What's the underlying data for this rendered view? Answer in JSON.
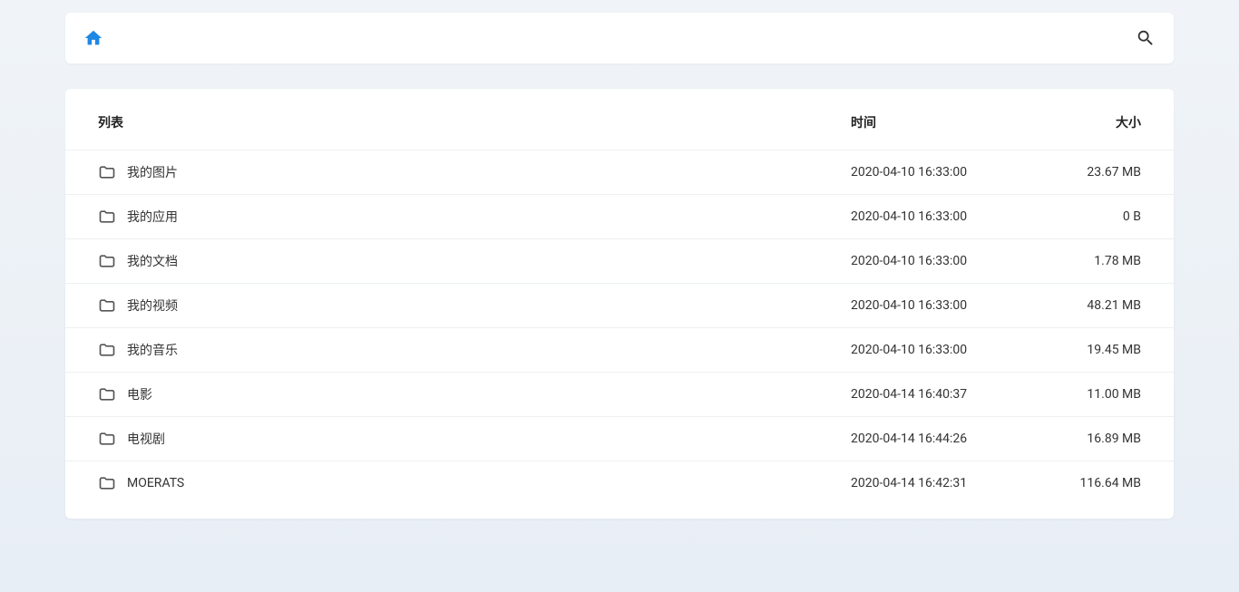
{
  "header": {
    "nameLabel": "列表",
    "timeLabel": "时间",
    "sizeLabel": "大小"
  },
  "rows": [
    {
      "name": "我的图片",
      "time": "2020-04-10 16:33:00",
      "size": "23.67 MB"
    },
    {
      "name": "我的应用",
      "time": "2020-04-10 16:33:00",
      "size": "0 B"
    },
    {
      "name": "我的文档",
      "time": "2020-04-10 16:33:00",
      "size": "1.78 MB"
    },
    {
      "name": "我的视频",
      "time": "2020-04-10 16:33:00",
      "size": "48.21 MB"
    },
    {
      "name": "我的音乐",
      "time": "2020-04-10 16:33:00",
      "size": "19.45 MB"
    },
    {
      "name": "电影",
      "time": "2020-04-14 16:40:37",
      "size": "11.00 MB"
    },
    {
      "name": "电视剧",
      "time": "2020-04-14 16:44:26",
      "size": "16.89 MB"
    },
    {
      "name": "MOERATS",
      "time": "2020-04-14 16:42:31",
      "size": "116.64 MB"
    }
  ]
}
